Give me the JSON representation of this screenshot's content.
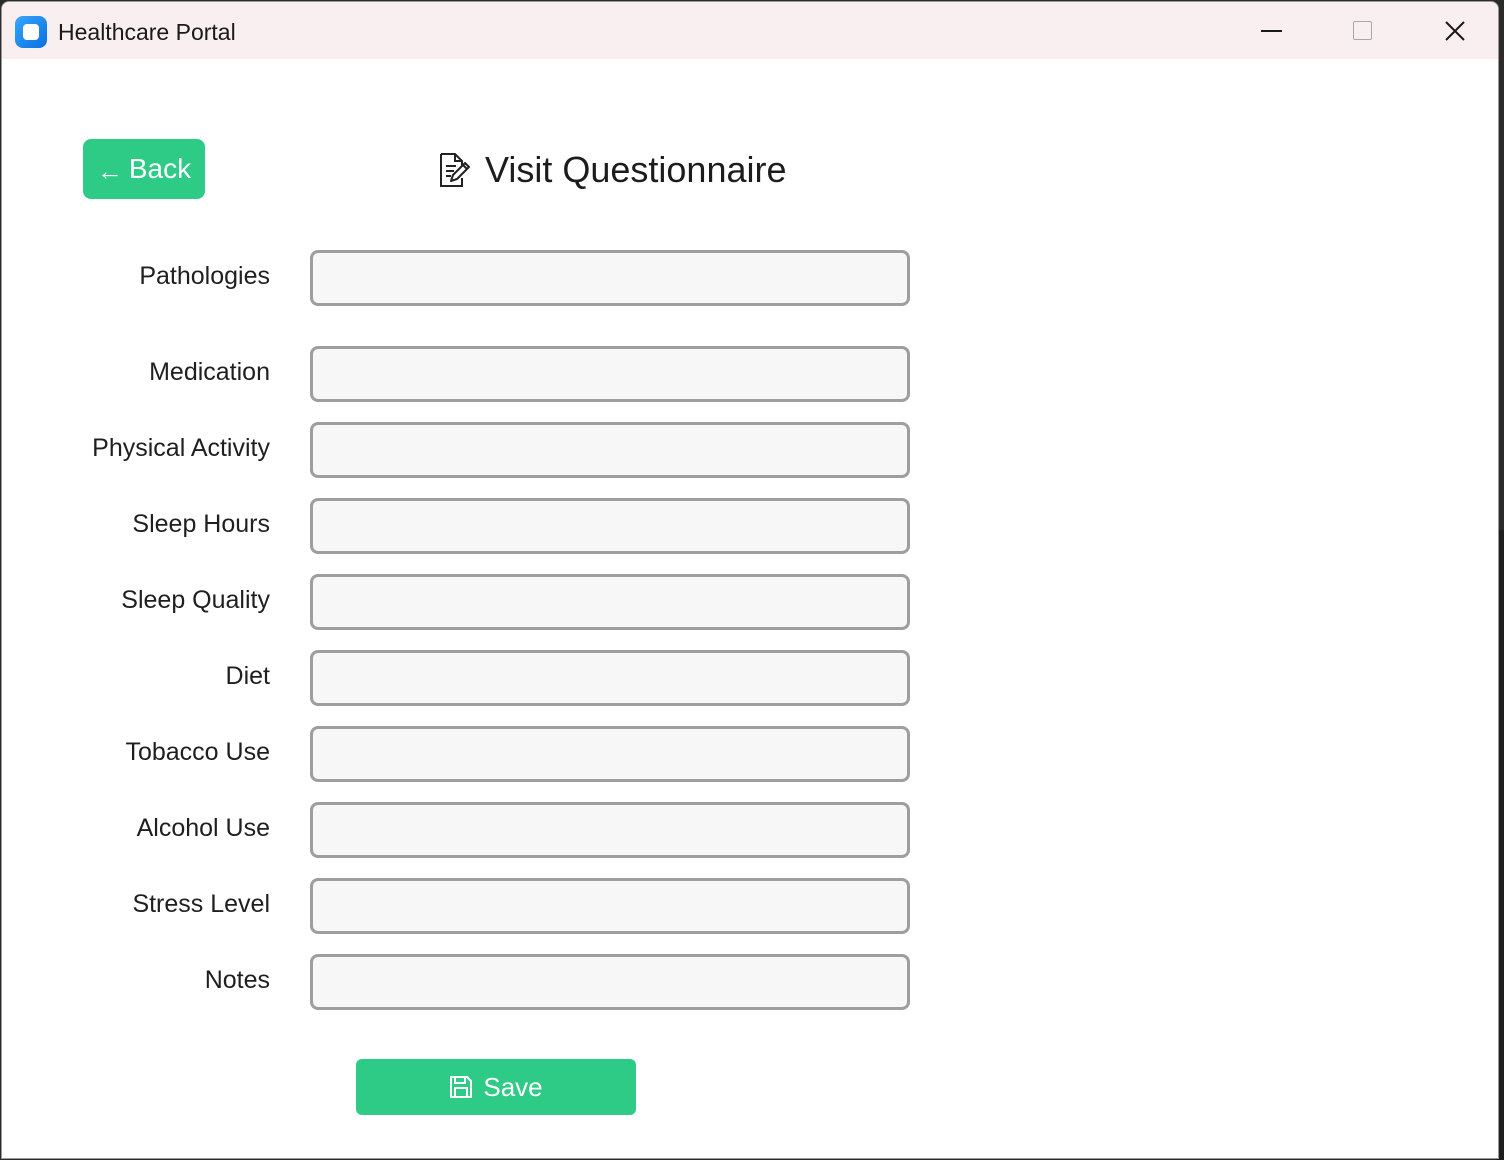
{
  "window": {
    "title": "Healthcare Portal",
    "accent": "#2ecb87"
  },
  "header": {
    "back_label": "Back",
    "back_icon": "arrow-left-icon",
    "title": "Visit Questionnaire",
    "title_icon": "edit-document-icon"
  },
  "form": {
    "fields": [
      {
        "label": "Pathologies",
        "value": ""
      },
      {
        "label": "Medication",
        "value": ""
      },
      {
        "label": "Physical Activity",
        "value": ""
      },
      {
        "label": "Sleep Hours",
        "value": ""
      },
      {
        "label": "Sleep Quality",
        "value": ""
      },
      {
        "label": "Diet",
        "value": ""
      },
      {
        "label": "Tobacco Use",
        "value": ""
      },
      {
        "label": "Alcohol Use",
        "value": ""
      },
      {
        "label": "Stress Level",
        "value": ""
      },
      {
        "label": "Notes",
        "value": ""
      }
    ],
    "save_label": "Save",
    "save_icon": "floppy-disk-icon"
  }
}
